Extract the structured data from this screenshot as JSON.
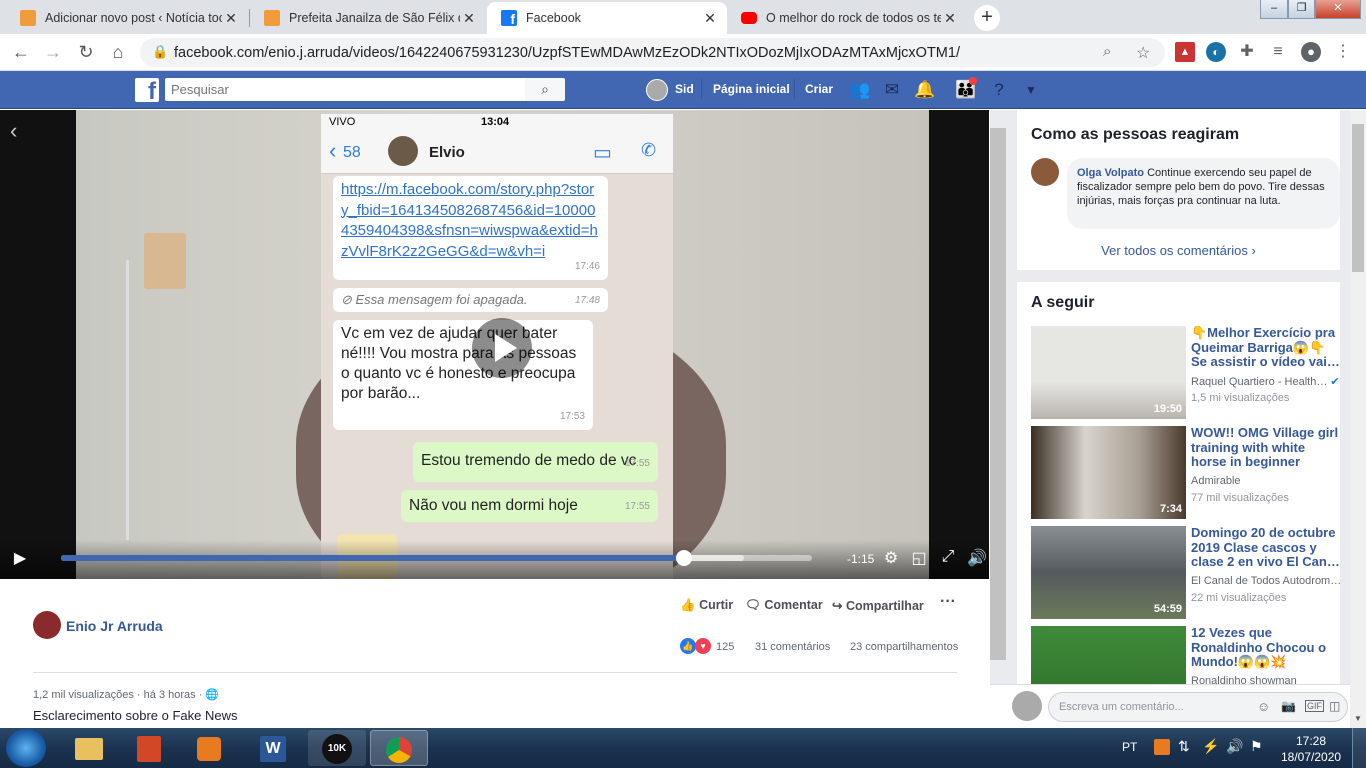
{
  "browser": {
    "tabs": [
      {
        "title": "Adicionar novo post ‹ Notícia toc",
        "favicon": "blog-favicon",
        "color": "#f29b3c"
      },
      {
        "title": "Prefeita Janailza de São Félix do /",
        "favicon": "blog-favicon",
        "color": "#f29b3c"
      },
      {
        "title": "Facebook",
        "favicon": "facebook-favicon",
        "color": "#1877f2"
      },
      {
        "title": "O melhor do rock de todos os te",
        "favicon": "youtube-favicon",
        "color": "#ff0000"
      }
    ],
    "url": "facebook.com/enio.j.arruda/videos/1642240675931230/UzpfSTEwMDAwMzEzODk2NTIxODozMjIxODAzMTAxMjcxOTM1/",
    "window_controls": [
      "–",
      "❐",
      "✕"
    ]
  },
  "fb": {
    "search_placeholder": "Pesquisar",
    "user_name": "Sid",
    "home": "Página inicial",
    "create": "Criar",
    "brand_color": "#4267b2"
  },
  "video": {
    "time_remaining": "-1:15",
    "progress": 0.83,
    "buffered": 0.91,
    "phone": {
      "carrier": "VIVO",
      "time": "13:04",
      "back_count": "58",
      "contact": "Elvio",
      "messages": [
        {
          "text": "https://m.facebook.com/story.php?story_fbid=1641345082687456&id=100004359404398&sfnsn=wiwspwa&extid=hzVvlF8rK2z2GeGG&d=w&vh=i",
          "time": "17:46"
        },
        {
          "text": "Essa mensagem foi apagada.",
          "time": "17:48"
        },
        {
          "text": "Vc em vez de ajudar quer bater né!!!! Vou mostra para as pessoas o quanto vc é honesto e preocupa por barão...",
          "time": "17:53"
        },
        {
          "text": "Estou tremendo de medo de vc",
          "time": "17:55"
        },
        {
          "text": "Não vou nem dormi hoje",
          "time": "17:55"
        }
      ]
    }
  },
  "post": {
    "author": "Enio Jr Arruda",
    "actions": {
      "like": "Curtir",
      "comment": "Comentar",
      "share": "Compartilhar"
    },
    "reactions": "125",
    "comments_count": "31 comentários",
    "shares_count": "23 compartilhamentos",
    "views": "1,2 mil visualizações",
    "time": "há 3 horas",
    "description": "Esclarecimento sobre o Fake News"
  },
  "reactions_panel": {
    "title": "Como as pessoas reagiram",
    "comment_author": "Olga Volpato",
    "comment_text": "Continue exercendo seu papel de fiscalizador sempre pelo bem do povo. Tire dessas injúrias, mais forças pra continuar na luta.",
    "see_all": "Ver todos os comentários"
  },
  "next_up": {
    "title": "A seguir",
    "videos": [
      {
        "title": "👇Melhor Exercício pra Queimar Barriga😱👇 Se assistir o vídeo vai…",
        "channel": "Raquel Quartiero - Health…",
        "views": "1,5 mi visualizações",
        "duration": "19:50"
      },
      {
        "title": "WOW!! OMG Village girl training with white horse in beginner",
        "channel": "Admirable",
        "views": "77 mil visualizações",
        "duration": "7:34"
      },
      {
        "title": "Domingo 20 de octubre 2019 Clase cascos y clase 2 en vivo El Can…",
        "channel": "El Canal de Todos Autodrom…",
        "views": "22 mi visualizações",
        "duration": "54:59"
      },
      {
        "title": "12 Vezes que Ronaldinho Chocou o Mundo!😱😱💥",
        "channel": "Ronaldinho showman",
        "views": "",
        "duration": ""
      }
    ]
  },
  "comment_box": {
    "placeholder": "Escreva um comentário..."
  },
  "taskbar": {
    "lang": "PT",
    "time": "17:28",
    "date": "18/07/2020",
    "apps": [
      "10K"
    ]
  }
}
